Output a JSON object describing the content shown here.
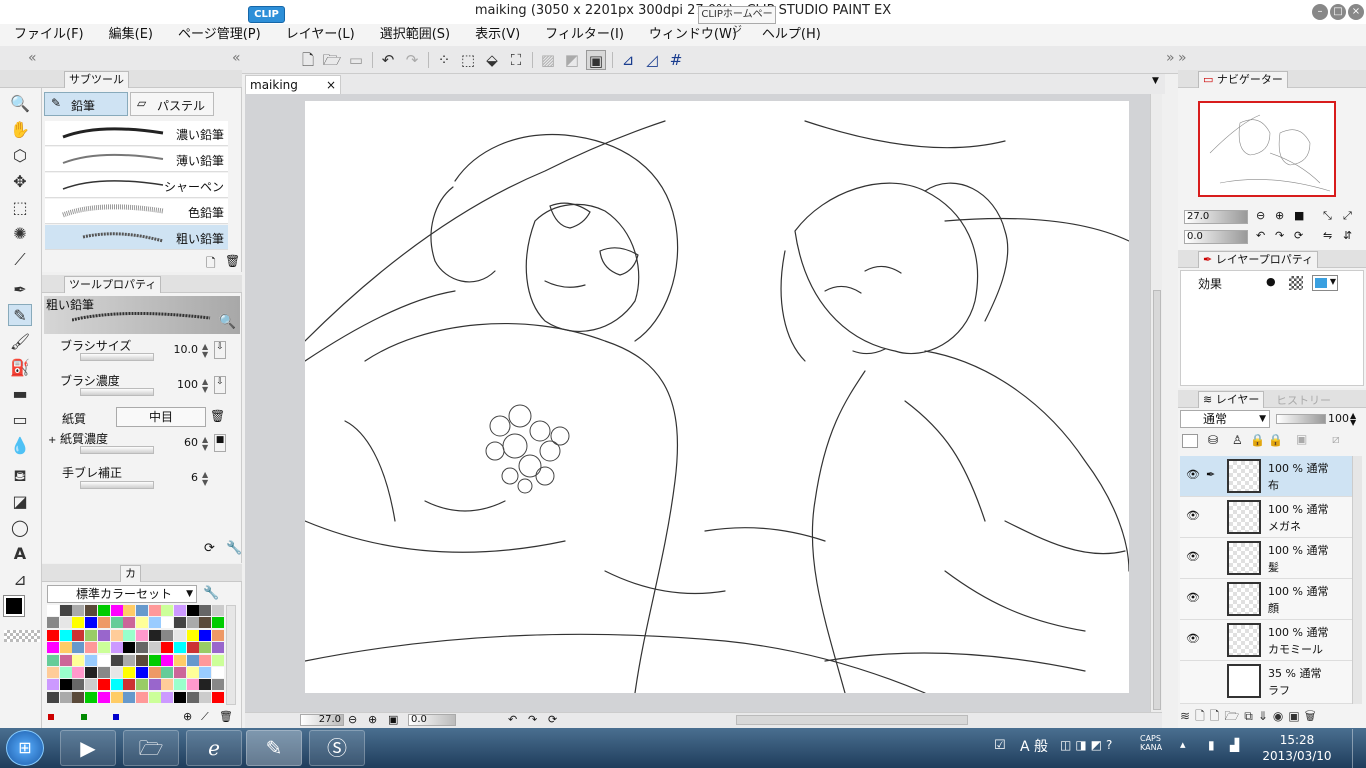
{
  "window": {
    "title": "maiking (3050 x 2201px 300dpi 27.0%)  - CLIP STUDIO PAINT EX"
  },
  "menu": [
    "ファイル(F)",
    "編集(E)",
    "ページ管理(P)",
    "レイヤー(L)",
    "選択範囲(S)",
    "表示(V)",
    "フィルター(I)",
    "ウィンドウ(W)",
    "ヘルプ(H)"
  ],
  "toolbar": {
    "clip_label": "CLIP",
    "home_label": "CLIPホームページ"
  },
  "subtool": {
    "tab": "サブツール",
    "groups": [
      "鉛筆",
      "パステル"
    ],
    "brushes": [
      "濃い鉛筆",
      "薄い鉛筆",
      "シャーペン",
      "色鉛筆",
      "粗い鉛筆"
    ],
    "selected": "粗い鉛筆"
  },
  "toolprop": {
    "tab": "ツールプロパティ",
    "preset": "粗い鉛筆",
    "brush_size_label": "ブラシサイズ",
    "brush_size": "10.0",
    "brush_density_label": "ブラシ濃度",
    "brush_density": "100",
    "paper_label": "紙質",
    "paper_value": "中目",
    "paper_density_label": "紙質濃度",
    "paper_density": "60",
    "stabilizer_label": "手ブレ補正",
    "stabilizer": "6"
  },
  "colorset": {
    "tab": "カ",
    "name": "標準カラーセット"
  },
  "document_tab": "maiking",
  "status": {
    "zoom": "27.0",
    "angle": "0.0"
  },
  "navigator": {
    "tab": "ナビゲーター",
    "zoom": "27.0",
    "angle": "0.0"
  },
  "layerprop": {
    "tab": "レイヤープロパティ",
    "effect_label": "効果"
  },
  "layers": {
    "tab": "レイヤー",
    "history_tab": "ヒストリー",
    "blend": "通常",
    "opacity": "100",
    "items": [
      {
        "pct": "100 %  通常",
        "name": "布"
      },
      {
        "pct": "100 %  通常",
        "name": "メガネ"
      },
      {
        "pct": "100 %  通常",
        "name": "髪"
      },
      {
        "pct": "100 %  通常",
        "name": "顔"
      },
      {
        "pct": "100 %  通常",
        "name": "カモミール"
      },
      {
        "pct": "35 %  通常",
        "name": "ラフ"
      }
    ]
  },
  "tray": {
    "ime": "A 般",
    "caps": "CAPS",
    "kana": "KANA",
    "time": "15:28",
    "date": "2013/03/10"
  },
  "colors": {
    "accent": "#2d8fd8",
    "selected_bg": "#cfe3f3",
    "nav_frame": "#d81c1c"
  }
}
